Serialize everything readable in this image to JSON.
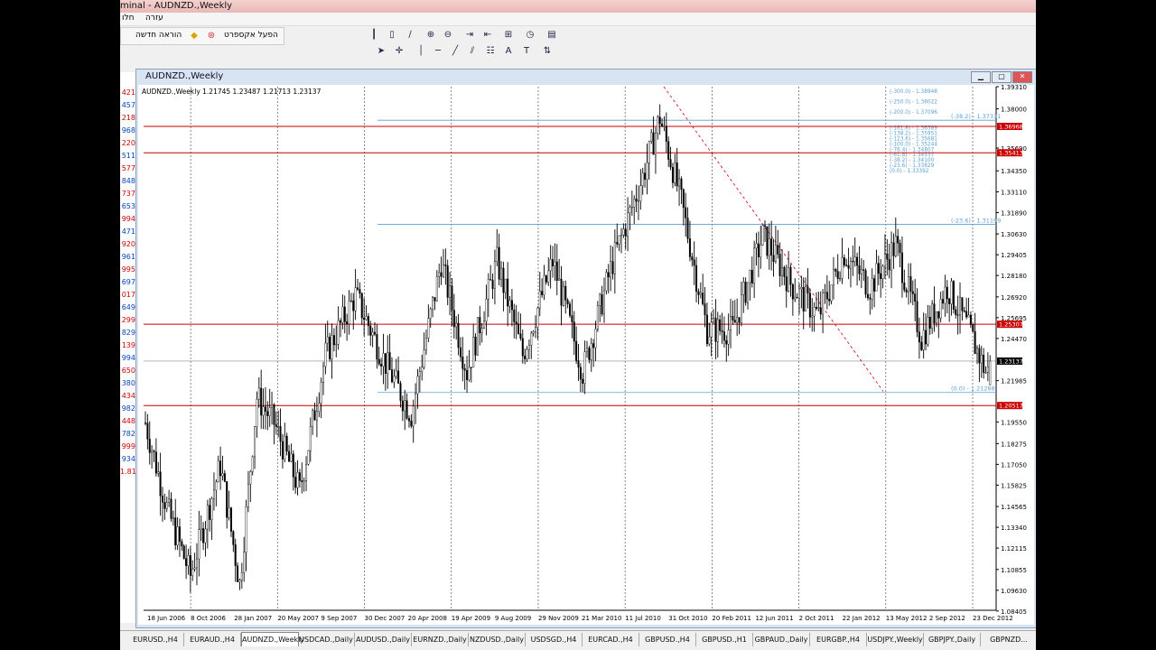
{
  "window": {
    "title": "minal - AUDNZD.,Weekly"
  },
  "menu": {
    "help": "עזרה",
    "window": "חלו"
  },
  "toolbar": {
    "new_order": "הוראה חדשה",
    "auto_trading": "הפעל אקספרט"
  },
  "chart_window": {
    "title": "AUDNZD.,Weekly",
    "info": "AUDNZD.,Weekly  1.21745 1.23487 1.21713 1.23137"
  },
  "nav_values": [
    "421",
    "457",
    "218",
    "968",
    "220",
    "511",
    "577",
    "848",
    "737",
    "653",
    "994",
    "471",
    "920",
    "961",
    "995",
    "697",
    "017",
    "649",
    "299",
    "829",
    "139",
    "994",
    "650",
    "380",
    "434",
    "982",
    "448",
    "782",
    "999",
    "934",
    "1.81"
  ],
  "colors": {
    "accent_red": "#cc0000",
    "fib_blue": "#5a9fd4",
    "window_blue": "#d8e4f2",
    "bg": "#ffffff"
  },
  "chart_data": {
    "type": "candlestick",
    "symbol": "AUDNZD.",
    "timeframe": "Weekly",
    "ohlc_last": {
      "open": 1.21745,
      "high": 1.23487,
      "low": 1.21713,
      "close": 1.23137
    },
    "current_price": "1.23137",
    "ylim": [
      1.0845,
      1.3931
    ],
    "y_ticks": [
      "1.39310",
      "1.38000",
      "1.35690",
      "1.34350",
      "1.33110",
      "1.31890",
      "1.30630",
      "1.29405",
      "1.28180",
      "1.26920",
      "1.25695",
      "1.24470",
      "1.21985",
      "1.19550",
      "1.18275",
      "1.17050",
      "1.15825",
      "1.14565",
      "1.13340",
      "1.12115",
      "1.10855",
      "1.09630",
      "1.08405"
    ],
    "x_ticks": [
      "18 Jun 2006",
      "8 Oct 2006",
      "28 Jan 2007",
      "20 May 2007",
      "9 Sep 2007",
      "30 Dec 2007",
      "20 Apr 2008",
      "19 Apr 2009",
      "9 Aug 2009",
      "29 Nov 2009",
      "21 Mar 2010",
      "11 Jul 2010",
      "31 Oct 2010",
      "20 Feb 2011",
      "12 Jun 2011",
      "2 Oct 2011",
      "22 Jan 2012",
      "13 May 2012",
      "2 Sep 2012",
      "23 Dec 2012"
    ],
    "red_levels": [
      {
        "price": 1.36968,
        "label": "1.36968"
      },
      {
        "price": 1.35413,
        "label": "1.35413"
      },
      {
        "price": 1.25307,
        "label": "1.25307"
      },
      {
        "price": 1.20517,
        "label": "1.20517"
      }
    ],
    "fib_lines": [
      {
        "price": 1.37331,
        "label": "(-38.2) - 1.37331"
      },
      {
        "price": 1.31199,
        "label": "(-23.6) - 1.31199"
      },
      {
        "price": 1.21288,
        "label": "(0.0) - 1.21288"
      }
    ],
    "fib_stack": [
      "(-300.0) - 1.38948",
      "(-250.0) - 1.38022",
      "(-200.0) - 1.37096",
      "(-161.8) - 1.36389",
      "(-138.2) - 1.35951",
      "(-123.6) - 1.35681",
      "(-100.0) - 1.35244",
      "(-76.4) - 1.34807",
      "(-61.8) - 1.34537",
      "(-38.2) - 1.34100",
      "(-23.6) - 1.33829",
      "(0.0) - 1.33392"
    ],
    "anchor_points": [
      {
        "date_index": 0,
        "price": 1.195
      },
      {
        "date_index": 10,
        "price": 1.145
      },
      {
        "date_index": 21,
        "price": 1.105
      },
      {
        "date_index": 35,
        "price": 1.17
      },
      {
        "date_index": 44,
        "price": 1.1
      },
      {
        "date_index": 52,
        "price": 1.21
      },
      {
        "date_index": 60,
        "price": 1.195
      },
      {
        "date_index": 72,
        "price": 1.155
      },
      {
        "date_index": 84,
        "price": 1.235
      },
      {
        "date_index": 98,
        "price": 1.27
      },
      {
        "date_index": 112,
        "price": 1.23
      },
      {
        "date_index": 124,
        "price": 1.2
      },
      {
        "date_index": 138,
        "price": 1.29
      },
      {
        "date_index": 150,
        "price": 1.225
      },
      {
        "date_index": 164,
        "price": 1.29
      },
      {
        "date_index": 176,
        "price": 1.235
      },
      {
        "date_index": 190,
        "price": 1.29
      },
      {
        "date_index": 204,
        "price": 1.225
      },
      {
        "date_index": 218,
        "price": 1.29
      },
      {
        "date_index": 232,
        "price": 1.34
      },
      {
        "date_index": 240,
        "price": 1.375
      },
      {
        "date_index": 250,
        "price": 1.325
      },
      {
        "date_index": 262,
        "price": 1.25
      },
      {
        "date_index": 274,
        "price": 1.25
      },
      {
        "date_index": 288,
        "price": 1.305
      },
      {
        "date_index": 302,
        "price": 1.275
      },
      {
        "date_index": 314,
        "price": 1.258
      },
      {
        "date_index": 326,
        "price": 1.295
      },
      {
        "date_index": 338,
        "price": 1.275
      },
      {
        "date_index": 350,
        "price": 1.3
      },
      {
        "date_index": 362,
        "price": 1.245
      },
      {
        "date_index": 374,
        "price": 1.275
      },
      {
        "date_index": 384,
        "price": 1.25
      },
      {
        "date_index": 392,
        "price": 1.225
      }
    ],
    "grid": true
  },
  "tabs": [
    "EURUSD.,H4",
    "EURAUD.,H4",
    "AUDNZD.,Weekly",
    "USDCAD.,Daily",
    "AUDUSD.,Daily",
    "EURNZD.,Daily",
    "NZDUSD.,Daily",
    "USDSGD.,H4",
    "EURCAD.,H4",
    "GBPUSD.,H4",
    "GBPUSD.,H1",
    "GBPAUD.,Daily",
    "EURGBP.,H4",
    "USDJPY.,Weekly",
    "GBPJPY.,Daily",
    "GBPNZD..."
  ],
  "active_tab": 2
}
